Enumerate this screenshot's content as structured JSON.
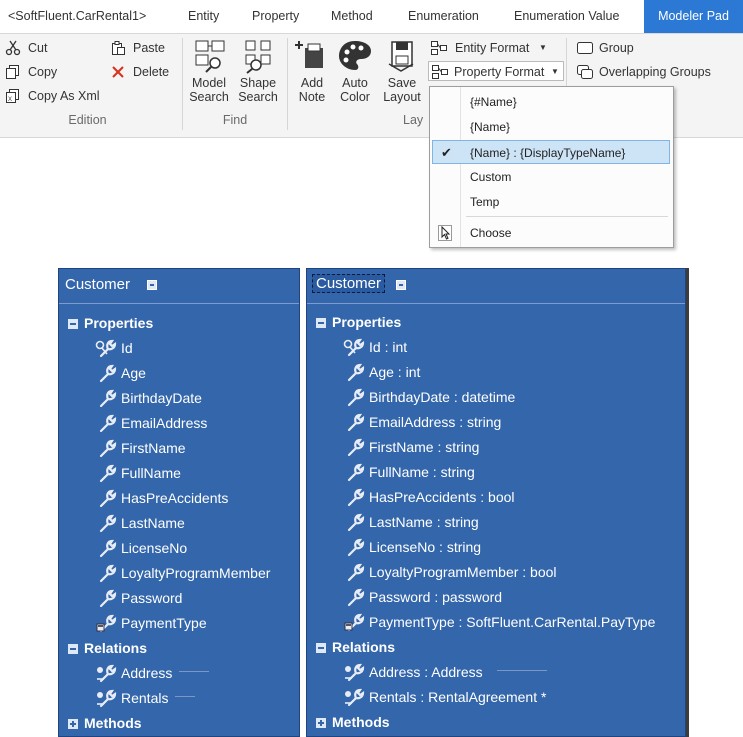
{
  "tabs": [
    "<SoftFluent.CarRental1>",
    "Entity",
    "Property",
    "Method",
    "Enumeration",
    "Enumeration Value",
    "Modeler Pad"
  ],
  "ribbon": {
    "edition": {
      "cut": "Cut",
      "copy": "Copy",
      "copy_as_xml": "Copy As Xml",
      "paste": "Paste",
      "delete": "Delete",
      "label": "Edition"
    },
    "find": {
      "model_search": [
        "Model",
        "Search"
      ],
      "shape_search": [
        "Shape",
        "Search"
      ],
      "label": "Find"
    },
    "layout": {
      "add_note": [
        "Add",
        "Note"
      ],
      "auto_color": [
        "Auto",
        "Color"
      ],
      "save_layout": [
        "Save",
        "Layout"
      ],
      "label_partial": "Lay",
      "entity_format": "Entity Format",
      "property_format": "Property Format"
    },
    "group": {
      "group": "Group",
      "overlapping_groups": "Overlapping Groups"
    }
  },
  "menu": {
    "items": [
      "{#Name}",
      "{Name}",
      "{Name} : {DisplayTypeName}",
      "Custom",
      "Temp"
    ],
    "selected_index": 2,
    "choose": "Choose"
  },
  "left_entity": {
    "title": "Customer",
    "properties_label": "Properties",
    "properties": [
      "Id",
      "Age",
      "BirthdayDate",
      "EmailAddress",
      "FirstName",
      "FullName",
      "HasPreAccidents",
      "LastName",
      "LicenseNo",
      "LoyaltyProgramMember",
      "Password",
      "PaymentType"
    ],
    "relations_label": "Relations",
    "relations": [
      "Address",
      "Rentals"
    ],
    "methods_label": "Methods"
  },
  "right_entity": {
    "title": "Customer",
    "properties_label": "Properties",
    "properties": [
      "Id : int",
      "Age : int",
      "BirthdayDate : datetime",
      "EmailAddress : string",
      "FirstName : string",
      "FullName : string",
      "HasPreAccidents : bool",
      "LastName : string",
      "LicenseNo : string",
      "LoyaltyProgramMember : bool",
      "Password : password",
      "PaymentType : SoftFluent.CarRental.PayType"
    ],
    "relations_label": "Relations",
    "relations": [
      "Address : Address",
      "Rentals : RentalAgreement *"
    ],
    "methods_label": "Methods"
  },
  "colors": {
    "accent_tab": "#2b79d4",
    "shape_fill": "#3366aa",
    "menu_selected": "#cde4f7"
  }
}
